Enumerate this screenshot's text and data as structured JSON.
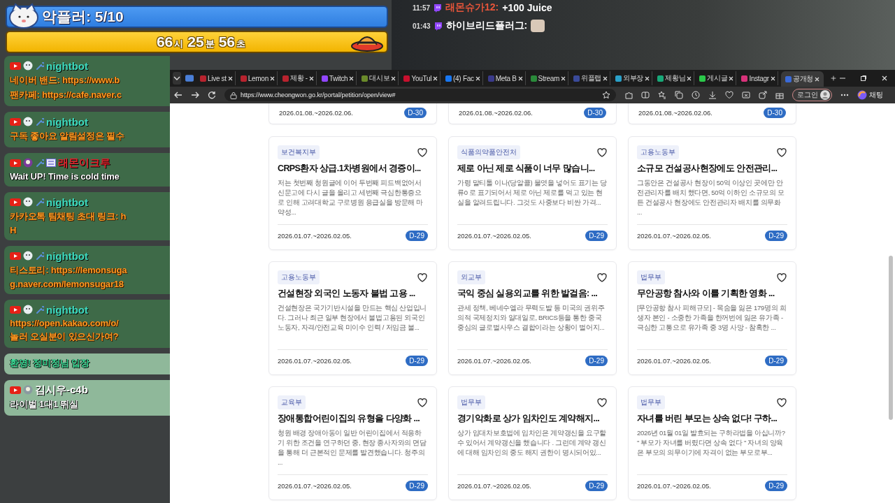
{
  "overlay": {
    "banner": "악플러: 5/10",
    "timer": [
      {
        "value": "66",
        "unit": "시"
      },
      {
        "value": "25",
        "unit": "분"
      },
      {
        "value": "56",
        "unit": "초"
      }
    ]
  },
  "stream_chat": [
    {
      "time": "11:57",
      "user": "래몬슈가12:",
      "color": "#e8553a",
      "message": "+100 Juice",
      "emote": false
    },
    {
      "time": "01:43",
      "user": "하이브리드플러그:",
      "color": "#ffffff",
      "emote": true
    }
  ],
  "chat": [
    {
      "kind": "bot",
      "user": "nightbot",
      "color": "#3ddbc0",
      "lines": [
        "네이버 밴드: https://www.b",
        "팬카페: https://cafe.naver.c"
      ]
    },
    {
      "kind": "bot",
      "user": "nightbot",
      "color": "#3ddbc0",
      "lines": [
        "구독 좋아요 알림설정은 필수"
      ]
    },
    {
      "kind": "member",
      "user": "래몬이크루",
      "color": "#e0202a",
      "lines": [
        "Wait UP! Time is cold time"
      ]
    },
    {
      "kind": "bot",
      "user": "nightbot",
      "color": "#3ddbc0",
      "lines": [
        "카카오톡 팀채팅 초대 링크: h",
        "H"
      ]
    },
    {
      "kind": "bot",
      "user": "nightbot",
      "color": "#3ddbc0",
      "lines": [
        "티스토리: https://lemonsuga",
        "g.naver.com/lemonsugar18"
      ]
    },
    {
      "kind": "bot",
      "user": "nightbot",
      "color": "#3ddbc0",
      "lines": [
        "https://open.kakao.com/o/",
        "놀러 오실분이 있으신가여?"
      ]
    },
    {
      "kind": "system",
      "lines": [
        "환영! 정미정님 입장"
      ]
    },
    {
      "kind": "viewer",
      "user": "김시우-c4b",
      "color": "#ffffff",
      "lines": [
        "라이벌 1대1 뛰실"
      ]
    }
  ],
  "browser": {
    "tabs": [
      {
        "label": "Live st",
        "selected": false
      },
      {
        "label": "Lemon",
        "selected": false
      },
      {
        "label": "제황 -",
        "selected": false
      },
      {
        "label": "Twitch",
        "selected": false
      },
      {
        "label": "대시보",
        "selected": false
      },
      {
        "label": "YouTul",
        "selected": false
      },
      {
        "label": "(4) Fac",
        "selected": false
      },
      {
        "label": "Meta B",
        "selected": false
      },
      {
        "label": "Stream",
        "selected": false
      },
      {
        "label": "위플랩",
        "selected": false
      },
      {
        "label": "외부장",
        "selected": false
      },
      {
        "label": "제황님",
        "selected": false
      },
      {
        "label": "게시글",
        "selected": false
      },
      {
        "label": "Instagr",
        "selected": false
      },
      {
        "label": "공개청",
        "selected": true
      }
    ],
    "url": "https://www.cheongwon.go.kr/portal/petition/open/view#",
    "login": "로그인",
    "copilot": "채팅"
  },
  "previous_row": [
    {
      "date": "2026.01.08.~2026.02.06.",
      "dday": "D-30"
    },
    {
      "date": "2026.01.08.~2026.02.06.",
      "dday": "D-30"
    },
    {
      "date": "2026.01.08.~2026.02.06.",
      "dday": "D-30"
    }
  ],
  "cards": [
    {
      "agency": "보건복지부",
      "title": "CRPS환자 상급.1차병원에서 경증이...",
      "summary": "저는 첫번째 청원글에 이어 두번째 피드백없어서 신문고에 다시 글을 올리고 세번째 극심한통증으로 인해 고려대학교 구로병원 응급실을 방문해 마약성...",
      "date": "2026.01.07.~2026.02.05.",
      "dday": "D-29",
      "liked": false
    },
    {
      "agency": "식품의약품안전처",
      "title": "제로 아닌 제로 식품이 너무 많습니...",
      "summary": "가령 말티톨 이나(당알콜) 물엿을 넣어도 표기는 당류0 로 표기되어서 제로 아닌 제로를 먹고 있는 현실을 알려드립니다. 그것도 사중보다 비싼 가격...",
      "date": "2026.01.07.~2026.02.05.",
      "dday": "D-29",
      "liked": false
    },
    {
      "agency": "고용노동부",
      "title": "소규모 건설공사현장에도 안전관리...",
      "summary": "그동안은 건설공사 현장이 50억 이상인 곳에만 안전관리자를 배치 했다면, 50억 이하인 소규모의 모든 건설공사 현장에도 안전관리자 배치를 의무화 ...",
      "date": "2026.01.07.~2026.02.05.",
      "dday": "D-29",
      "liked": false
    },
    {
      "agency": "고용노동부",
      "title": "건설현장 외국인 노동자 불법 고용 ...",
      "summary": "건설현장은 국가기반시설을 만드는 핵심 산업입니다. 그러나 최근 일부 현장에서 불법고용된 외국인 노동자, 자격/안전교육 미이수 인력 / 저임금 불...",
      "date": "2026.01.07.~2026.02.05.",
      "dday": "D-29",
      "liked": false
    },
    {
      "agency": "외교부",
      "title": "국익 중심 실용외교를 위한 발걸음: ...",
      "summary": "관세 정책, 베네수엘라 무력도발 등 미국의 권위주의적 국제정치와 일대일로, BRICS등을 통한 중국 중심의 글로벌사우스 결합이라는 상황이 벌어지...",
      "date": "2026.01.07.~2026.02.05.",
      "dday": "D-29",
      "liked": false
    },
    {
      "agency": "법무부",
      "title": "무안공항 참사와 이를 기획한 영화 ...",
      "summary": "[무안공항 참사 피해규모] - 목숨을 잃은 179명의 희생자 본인 - 소중한 가족을 한꺼번에 잃은 유가족 - 극심한 고통으로 유가족 중 3명 사망 - 참혹한 ...",
      "date": "2026.01.07.~2026.02.05.",
      "dday": "D-29",
      "liked": false
    },
    {
      "agency": "교육부",
      "title": "장애통합어린이집의 유형을 다양화 ...",
      "summary": "청원 배경 장애아동이 일반 어린이집에서 적응하기 위한 조건을 연구하던 중, 현장 종사자와의 면담을 통해 더 근본적인 문제를 발견했습니다. 청주의 ...",
      "date": "2026.01.07.~2026.02.05.",
      "dday": "D-29",
      "liked": false
    },
    {
      "agency": "법무부",
      "title": "경기악화로 상가 임차인도 계약해지...",
      "summary": "상가 임대차보호법에 임차인은 계약갱신을 요구할 수 있어서 계약갱신을 했습니다 . 그런데 계약 갱신에 대해 임차인의 중도 해지 권한이 명시되어있...",
      "date": "2026.01.07.~2026.02.05.",
      "dday": "D-29",
      "liked": false
    },
    {
      "agency": "법무부",
      "title": "자녀를 버린 부모는 상속 없다! 구하...",
      "summary": "2026년 01월 01일 발효되는 구하라법을 아십니까? \" 부모가 자녀를 버렸다면 상속 없다 \" 자녀의 양육은 부모의 의무이기에 자격이 없는 부모로부...",
      "date": "2026.01.07.~2026.02.05.",
      "dday": "D-29",
      "liked": false
    }
  ]
}
